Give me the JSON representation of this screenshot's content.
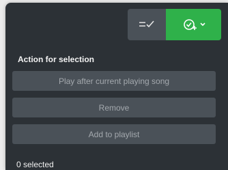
{
  "toolbar": {
    "sort_icon": "checklist-sort-icon",
    "select_icon": "check-circle-plus-icon",
    "dropdown_icon": "chevron-down-icon",
    "accent_color": "#2fb14a",
    "button_color": "#4a5158"
  },
  "actions": {
    "title": "Action for selection",
    "play_after_current": "Play after current playing song",
    "remove": "Remove",
    "add_to_playlist": "Add to playlist"
  },
  "status": {
    "selected_count": "0 selected"
  },
  "colors": {
    "panel_background": "#2c3136",
    "text_primary": "#f2f2f2",
    "text_disabled": "#a4a9ae"
  }
}
